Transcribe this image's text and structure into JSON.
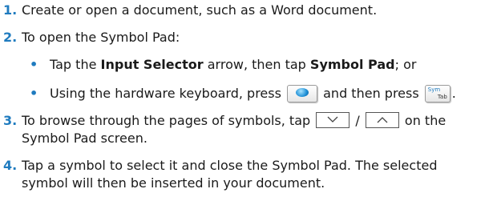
{
  "items": [
    {
      "number": "1.",
      "text": "Create or open a document, such as a Word document."
    },
    {
      "number": "2.",
      "text": "To open the Symbol Pad:",
      "bullets": [
        {
          "marker": "•",
          "pre": "Tap the ",
          "bold1": "Input Selector",
          "mid": " arrow, then tap ",
          "bold2": "Symbol Pad",
          "post": "; or"
        },
        {
          "marker": "•",
          "pre": "Using the hardware keyboard, press ",
          "mid": " and then press ",
          "post": ".",
          "sym_key_top": "Sym",
          "sym_key_bottom": "Tab"
        }
      ]
    },
    {
      "number": "3.",
      "line1_pre": "To browse through the pages of symbols, tap ",
      "line1_sep": " / ",
      "line1_post": " on the",
      "line2": "Symbol Pad screen."
    },
    {
      "number": "4.",
      "line1": "Tap a symbol to select it and close the Symbol Pad. The selected",
      "line2": "symbol will then be inserted in your document."
    }
  ],
  "colors": {
    "accent": "#1f7bbf",
    "text": "#1a1a1a"
  },
  "icons": {
    "windows_key": "windows-key-icon",
    "down": "chevron-down-icon",
    "up": "chevron-up-icon"
  }
}
